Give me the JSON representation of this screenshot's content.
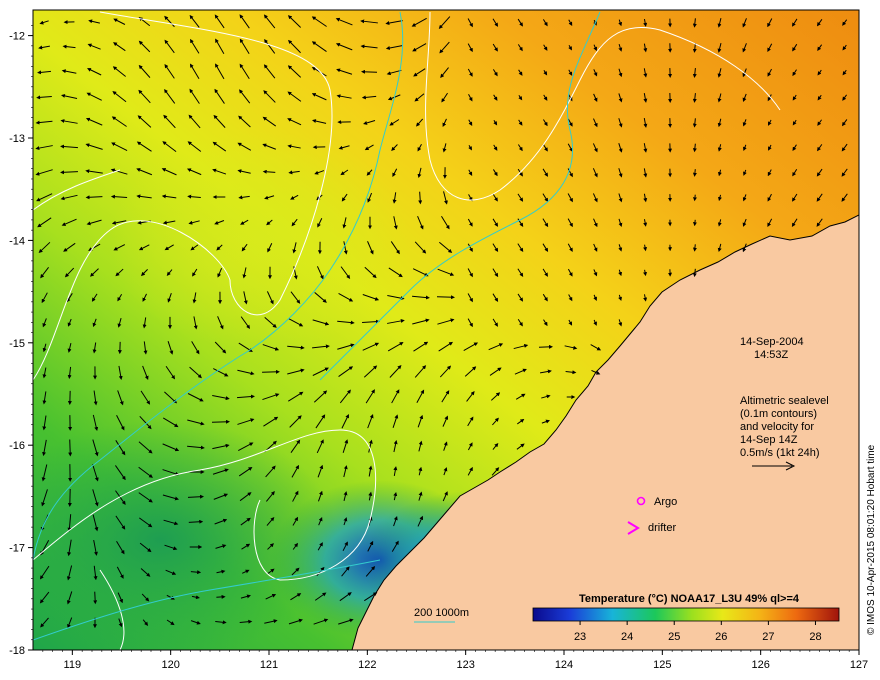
{
  "map": {
    "lon_range": [
      118.6,
      127.0
    ],
    "lat_range": [
      -18.0,
      -11.75
    ],
    "x_ticks": [
      {
        "value": 119,
        "label": "119"
      },
      {
        "value": 120,
        "label": "120"
      },
      {
        "value": 121,
        "label": "121"
      },
      {
        "value": 122,
        "label": "122"
      },
      {
        "value": 123,
        "label": "123"
      },
      {
        "value": 124,
        "label": "124"
      },
      {
        "value": 125,
        "label": "125"
      },
      {
        "value": 126,
        "label": "126"
      },
      {
        "value": 127,
        "label": "127"
      }
    ],
    "y_ticks": [
      {
        "value": -12,
        "label": "-12"
      },
      {
        "value": -13,
        "label": "-13"
      },
      {
        "value": -14,
        "label": "-14"
      },
      {
        "value": -15,
        "label": "-15"
      },
      {
        "value": -16,
        "label": "-16"
      },
      {
        "value": -17,
        "label": "-17"
      },
      {
        "value": -18,
        "label": "-18"
      }
    ],
    "date": "14-Sep-2004",
    "time": "14:53Z",
    "info_lines": [
      "Altimetric sealevel",
      "(0.1m contours)",
      "and velocity for",
      "14-Sep 14Z",
      "0.5m/s (1kt 24h)"
    ],
    "legend_argo": "Argo",
    "legend_drifter": "drifter",
    "bathy_label": "200  1000m",
    "colorbar_title": "Temperature (°C) NOAA17_L3U 49% ql>=4",
    "colorbar_ticks": [
      "23",
      "24",
      "25",
      "26",
      "27",
      "28"
    ],
    "colorbar_range": [
      22.0,
      28.5
    ],
    "credit": "© IMOS 10-Apr-2015 08:01:20 Hobart time",
    "colors": {
      "land": "#f9c9a1",
      "coast": "#000000",
      "bathy": "#33cccc",
      "contour": "#ffffff",
      "argo": "#ff00ff",
      "drifter": "#ff00ff"
    }
  }
}
